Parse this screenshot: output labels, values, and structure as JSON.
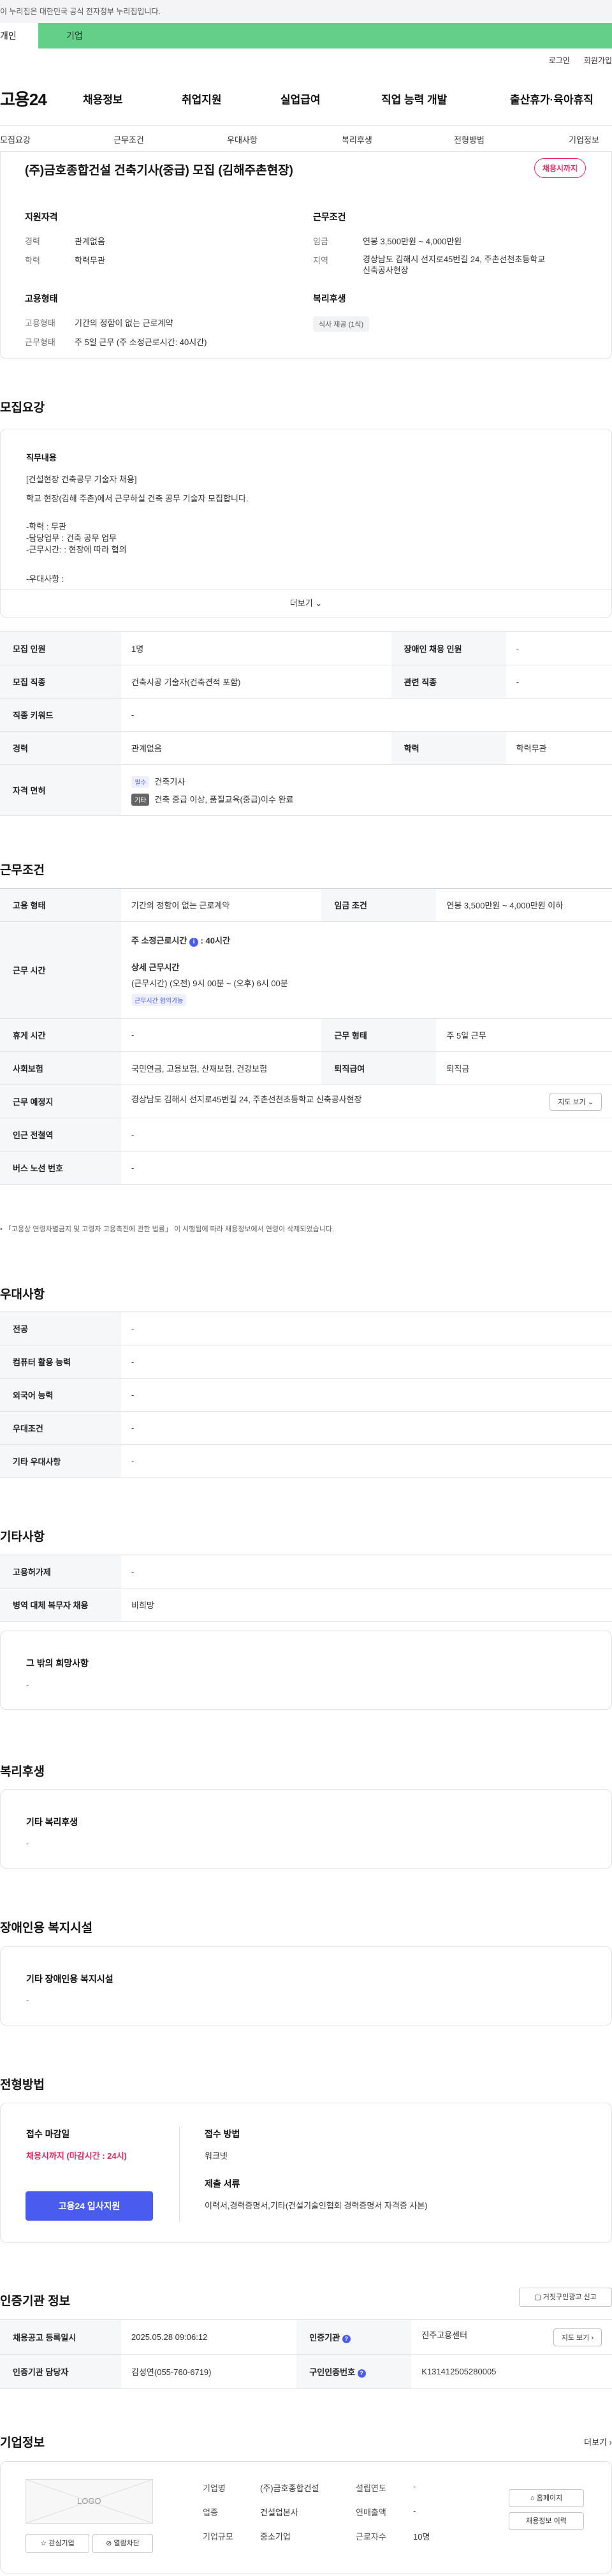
{
  "gov_notice": "이 누리집은 대한민국 공식 전자정부 누리집입니다.",
  "site_tabs": {
    "individual": "개인",
    "corporate": "기업"
  },
  "utility": {
    "login": "로그인",
    "signup": "회원가입"
  },
  "logo": "고용24",
  "gnb": [
    "채용정보",
    "취업지원",
    "실업급여",
    "직업 능력 개발",
    "출산휴가·육아휴직"
  ],
  "sub_nav": [
    "모집요강",
    "근무조건",
    "우대사항",
    "복리후생",
    "전형방법",
    "기업정보"
  ],
  "job": {
    "title": "(주)금호종합건설 건축기사(중급) 모집 (김해주촌현장)",
    "status": "채용시까지",
    "qualification": {
      "heading": "지원자격",
      "career_label": "경력",
      "career": "관계없음",
      "edu_label": "학력",
      "edu": "학력무관"
    },
    "conditions": {
      "heading": "근무조건",
      "wage_label": "임금",
      "wage": "연봉 3,500만원 ~ 4,000만원",
      "region_label": "지역",
      "region_line1": "경상남도 김해시 선지로45번길 24, 주촌선천초등학교",
      "region_line2": "신축공사현장"
    },
    "employment": {
      "heading": "고용형태",
      "type_label": "고용형태",
      "type": "기간의 정함이 없는 근로계약",
      "hours_label": "근무형태",
      "hours": "주 5일 근무 (주 소정근로시간: 40시간)"
    },
    "welfare": {
      "heading": "복리후생",
      "chip": "식사 제공 (1식)"
    }
  },
  "sections": {
    "recruit": "모집요강",
    "work": "근무조건",
    "preferred": "우대사항",
    "other": "기타사항",
    "welfare": "복리후생",
    "facilities": "장애인용 복지시설",
    "screening": "전형방법",
    "agency": "인증기관 정보",
    "company": "기업정보"
  },
  "description": {
    "heading": "직무내용",
    "lines": [
      "[건설현장 건축공무 기술자 채용]",
      "학교 현장(김해 주촌)에서 근무하실 건축 공무 기술자 모집합니다.",
      "-학력 : 무관",
      "-담당업무 : 건축 공무 업무",
      "-근무시간: : 현장에 따라 협의",
      "-우대사항 :"
    ],
    "more": "더보기"
  },
  "recruit_table": {
    "headcount_label": "모집 인원",
    "headcount": "1명",
    "disabled_label": "장애인 채용 인원",
    "disabled": "-",
    "job_label": "모집 직종",
    "job": "건축시공 기술자(건축견적 포함)",
    "related_label": "관련 직종",
    "related": "-",
    "keyword_label": "직종 키워드",
    "keyword": "-",
    "career_label": "경력",
    "career": "관계없음",
    "edu_label": "학력",
    "edu": "학력무관",
    "license_label": "자격 면허",
    "license_chip1": "필수",
    "license1": "건축기사",
    "license_chip2": "기타",
    "license2": "건축 중급 이상, 품질교육(중급)이수 완료"
  },
  "work_table": {
    "type_label": "고용 형태",
    "type": "기간의 정함이 없는 근로계약",
    "wage_label": "임금 조건",
    "wage": "연봉 3,500만원 ~ 4,000만원 이하",
    "hours_label": "근무 시간",
    "weekly": "주 소정근로시간",
    "weekly_val": "40시간",
    "detail_label": "상세 근무시간",
    "detail": "(근무시간) (오전) 9시 00분 ~ (오후) 6시 00분",
    "detail_chip": "근무시간 협의가능",
    "break_label": "휴게 시간",
    "break": "-",
    "shift_label": "근무 형태",
    "shift": "주 5일 근무",
    "insurance_label": "사회보험",
    "insurance": "국민연금, 고용보험, 산재보험, 건강보험",
    "severance_label": "퇴직급여",
    "severance": "퇴직금",
    "location_label": "근무 예정지",
    "location": "경상남도 김해시 선지로45번길 24, 주촌선천초등학교 신축공사현장",
    "map": "지도 보기",
    "subway_label": "인근 전철역",
    "subway": "-",
    "bus_label": "버스 노선 번호",
    "bus": "-"
  },
  "work_note": "「고용상 연령차별금지 및 고령자 고용촉진에 관한 법률」 이 시행됨에 따라 채용정보에서 연령이 삭제되었습니다.",
  "preferred_table": [
    {
      "label": "전공",
      "value": "-"
    },
    {
      "label": "컴퓨터 활용 능력",
      "value": "-"
    },
    {
      "label": "외국어 능력",
      "value": "-"
    },
    {
      "label": "우대조건",
      "value": "-"
    },
    {
      "label": "기타 우대사항",
      "value": "-"
    }
  ],
  "other_table": [
    {
      "label": "고용허가제",
      "value": "-"
    },
    {
      "label": "병역 대체 복무자 채용",
      "value": "비희망"
    }
  ],
  "other_box": {
    "heading": "그 밖의 희망사항",
    "value": "-"
  },
  "welfare_box": {
    "heading": "기타 복리후생",
    "value": "-"
  },
  "facilities_box": {
    "heading": "기타 장애인용 복지시설",
    "value": "-"
  },
  "screening": {
    "deadline_label": "접수 마감일",
    "deadline": "채용시까지 (마감시간 : 24시)",
    "apply": "고용24 입사지원",
    "method_label": "접수 방법",
    "method": "워크넷",
    "docs_label": "제출 서류",
    "docs": "이력서,경력증명서,기타(건설기술인협회 경력증명서 자격증 사본)"
  },
  "agency": {
    "report": "거짓구인광고 신고",
    "reg_label": "채용공고 등록일시",
    "reg": "2025.05.28 09:06:12",
    "org_label": "인증기관",
    "org": "진주고용센터",
    "map": "지도 보기",
    "manager_label": "인증기관 담당자",
    "manager": "김성연(055-760-6719)",
    "num_label": "구인인증번호",
    "num": "K131412505280005"
  },
  "company": {
    "more": "더보기",
    "logo": "LOGO",
    "interest": "관심기업",
    "block": "열람차단",
    "name_label": "기업명",
    "name": "(주)금호종합건설",
    "year_label": "설립연도",
    "year": "-",
    "industry_label": "업종",
    "industry": "건설업본사",
    "sales_label": "연매출액",
    "sales": "-",
    "size_label": "기업규모",
    "size": "중소기업",
    "emp_label": "근로자수",
    "emp": "10명",
    "homepage": "홈페이지",
    "history": "채용정보 이력"
  }
}
